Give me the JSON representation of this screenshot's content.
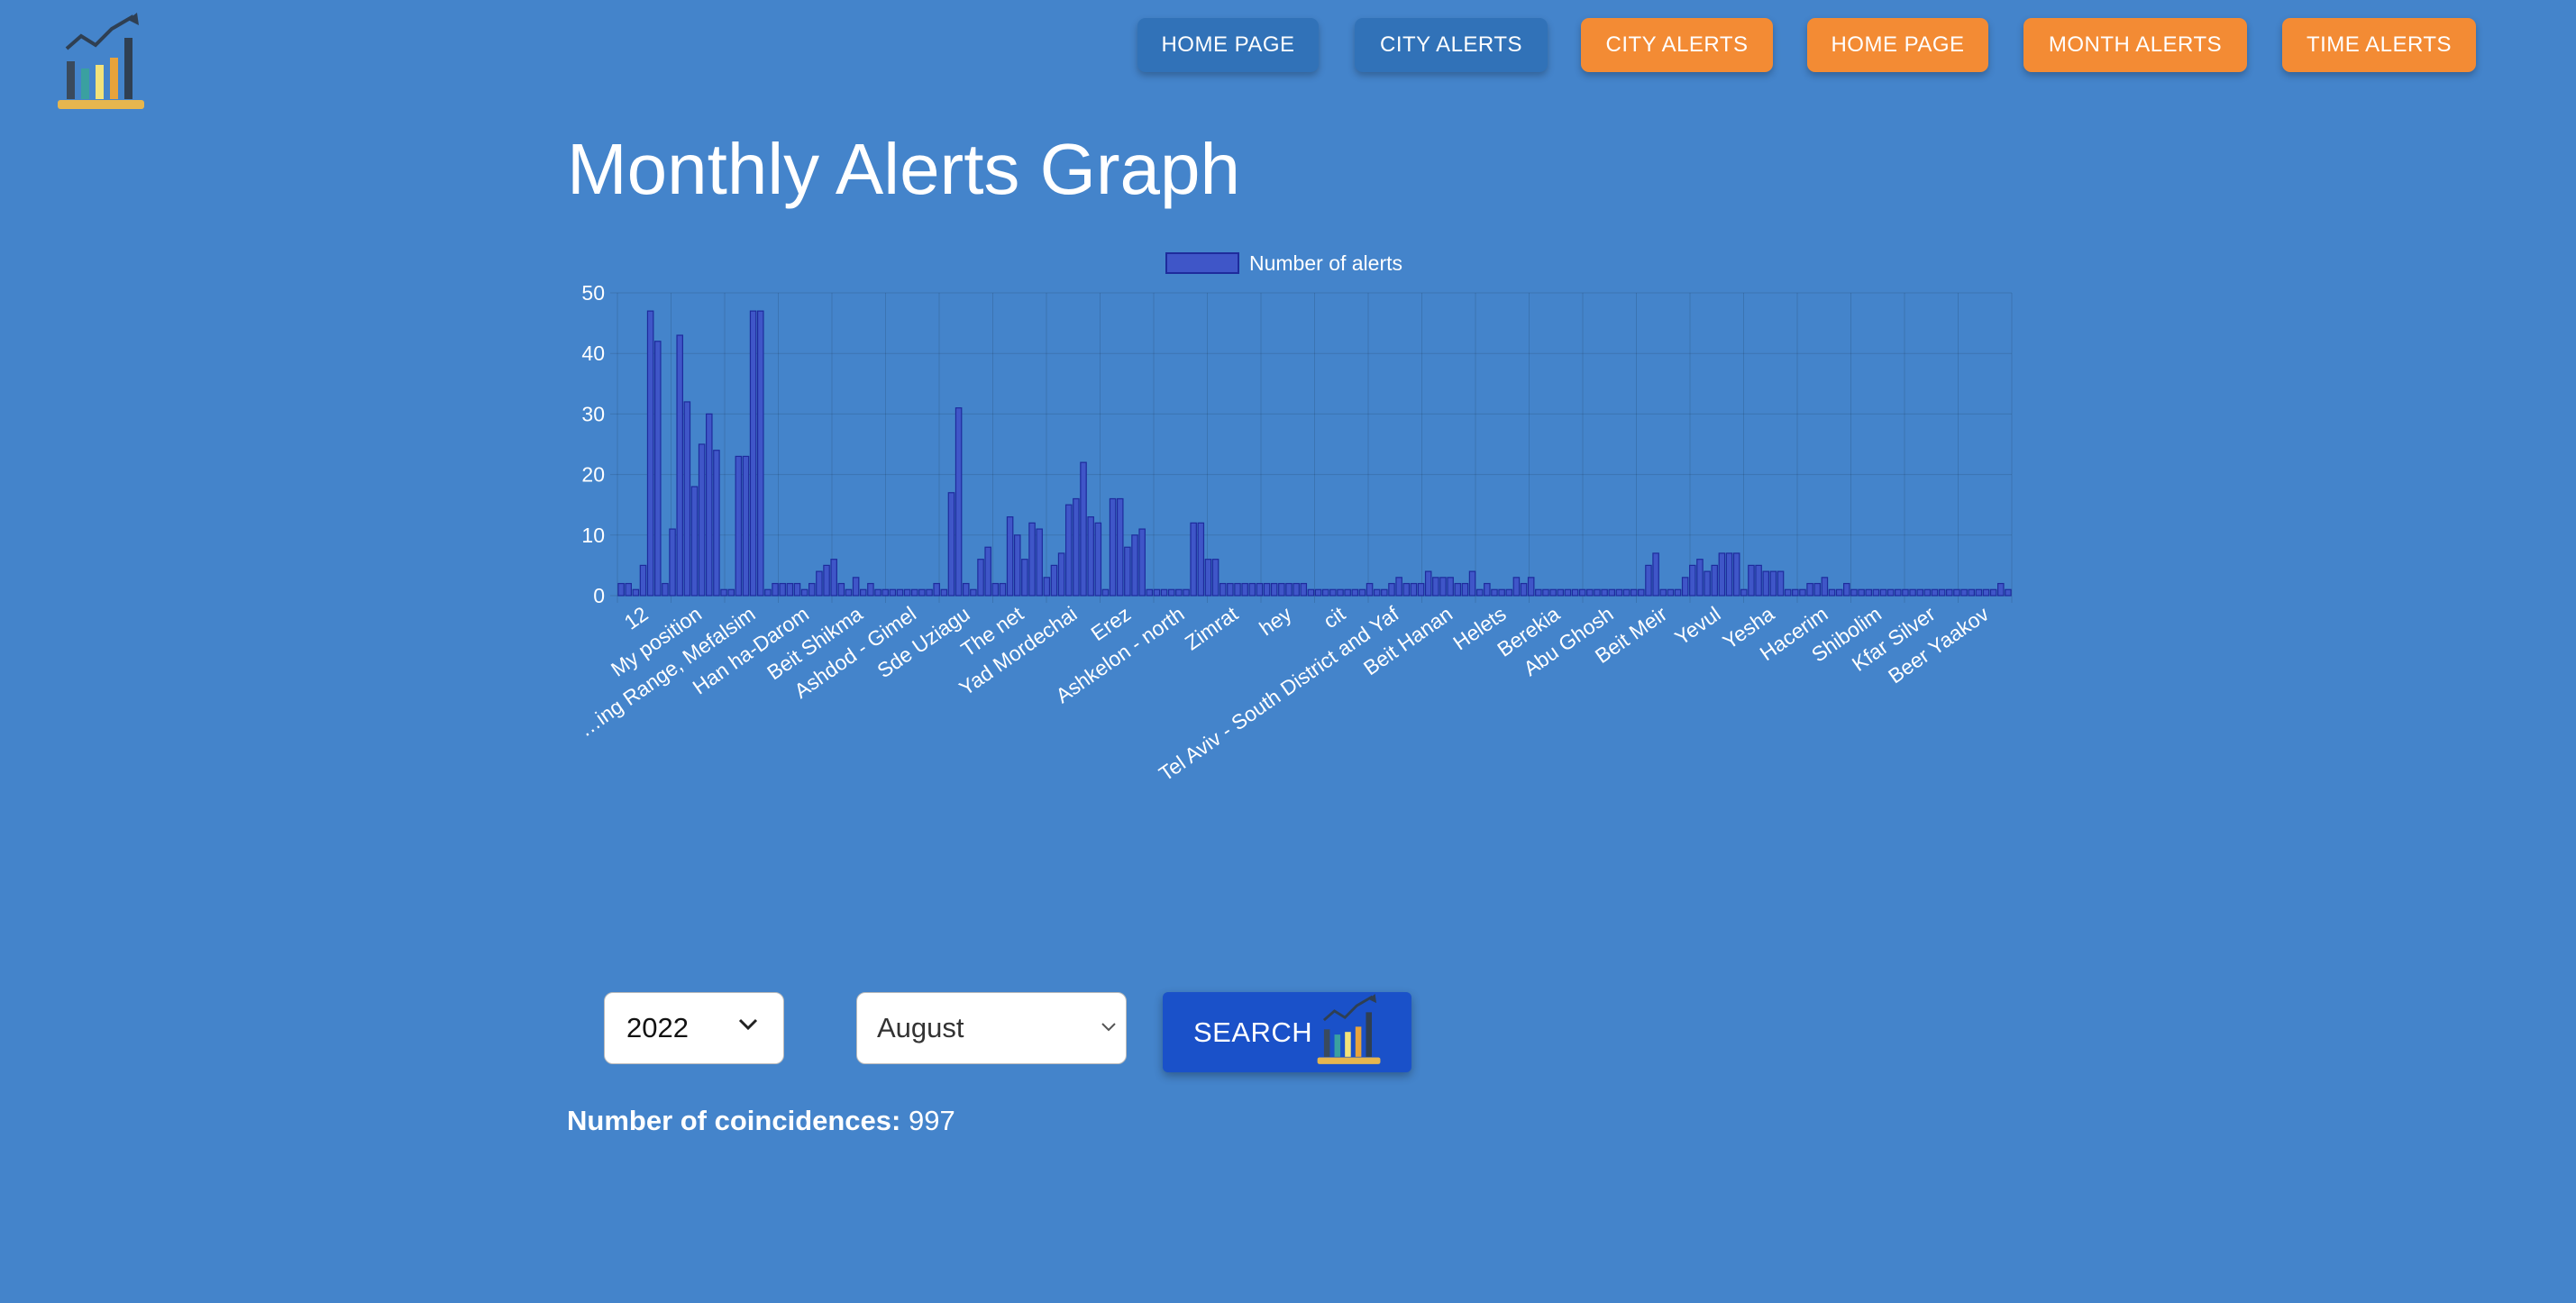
{
  "nav": {
    "buttons": [
      "HOME PAGE",
      "CITY ALERTS",
      "CITY ALERTS",
      "HOME PAGE",
      "MONTH ALERTS",
      "TIME ALERTS"
    ]
  },
  "page": {
    "title": "Monthly Alerts Graph"
  },
  "logo_icon": "bar-chart-growth-icon",
  "colors": {
    "background": "#4484cb",
    "nav_blue": "#3172b8",
    "nav_orange": "#f38b34",
    "bar_fill": "#3f56c8",
    "bar_border": "#1e2b9c",
    "search_button": "#1a51c9"
  },
  "filters": {
    "year": "2022",
    "month": "August",
    "search_label": "SEARCH"
  },
  "result": {
    "label": "Number of coincidences:",
    "value": "997"
  },
  "chart_data": {
    "type": "bar",
    "title": "",
    "xlabel": "",
    "ylabel": "",
    "ylim": [
      0,
      50
    ],
    "yticks": [
      0,
      10,
      20,
      30,
      40,
      50
    ],
    "legend": {
      "position": "top",
      "label": "Number of alerts"
    },
    "grid": true,
    "visible_tick_labels": [
      "12",
      "My position",
      "…ing Range, Mefalsim",
      "Han ha-Darom",
      "Beit Shikma",
      "Ashdod - Gimel",
      "Sde Uziagu",
      "The net",
      "Yad Mordechai",
      "Erez",
      "Ashkelon - north",
      "Zimrat",
      "hey",
      "cit",
      "Tel Aviv - South District and Yaf",
      "Beit Hanan",
      "Helets",
      "Berekia",
      "Abu Ghosh",
      "Beit Meir",
      "Yevul",
      "Yesha",
      "Hacerim",
      "Shibolim",
      "Kfar Silver",
      "Beer Yaakov"
    ],
    "series": [
      {
        "name": "Number of alerts",
        "values": [
          2,
          2,
          1,
          5,
          47,
          42,
          2,
          11,
          43,
          32,
          18,
          25,
          30,
          24,
          1,
          1,
          23,
          23,
          47,
          47,
          1,
          2,
          2,
          2,
          2,
          1,
          2,
          4,
          5,
          6,
          2,
          1,
          3,
          1,
          2,
          1,
          1,
          1,
          1,
          1,
          1,
          1,
          1,
          2,
          1,
          17,
          31,
          2,
          1,
          6,
          8,
          2,
          2,
          13,
          10,
          6,
          12,
          11,
          3,
          5,
          7,
          15,
          16,
          22,
          13,
          12,
          1,
          16,
          16,
          8,
          10,
          11,
          1,
          1,
          1,
          1,
          1,
          1,
          12,
          12,
          6,
          6,
          2,
          2,
          2,
          2,
          2,
          2,
          2,
          2,
          2,
          2,
          2,
          2,
          1,
          1,
          1,
          1,
          1,
          1,
          1,
          1,
          2,
          1,
          1,
          2,
          3,
          2,
          2,
          2,
          4,
          3,
          3,
          3,
          2,
          2,
          4,
          1,
          2,
          1,
          1,
          1,
          3,
          2,
          3,
          1,
          1,
          1,
          1,
          1,
          1,
          1,
          1,
          1,
          1,
          1,
          1,
          1,
          1,
          1,
          5,
          7,
          1,
          1,
          1,
          3,
          5,
          6,
          4,
          5,
          7,
          7,
          7,
          1,
          5,
          5,
          4,
          4,
          4,
          1,
          1,
          1,
          2,
          2,
          3,
          1,
          1,
          2,
          1,
          1,
          1,
          1,
          1,
          1,
          1,
          1,
          1,
          1,
          1,
          1,
          1,
          1,
          1,
          1,
          1,
          1,
          1,
          1,
          2,
          1
        ]
      }
    ]
  }
}
